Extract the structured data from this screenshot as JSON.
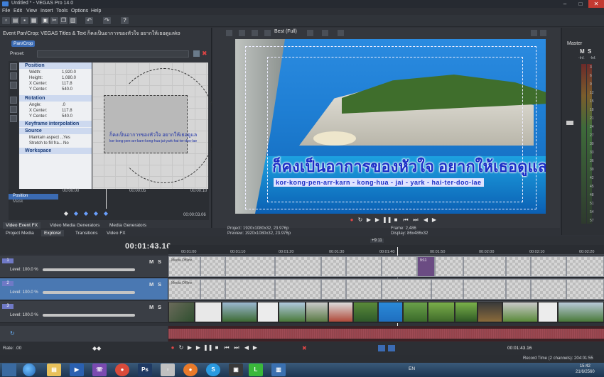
{
  "window": {
    "title": "Untitled * - VEGAS Pro 14.0",
    "min": "–",
    "max": "□",
    "close": "✕"
  },
  "menu": [
    "File",
    "Edit",
    "View",
    "Insert",
    "Tools",
    "Options",
    "Help"
  ],
  "event_panel": {
    "header": "Event Pan/Crop:  VEGAS Titles & Text ก็คงเป็นอาการของหัวใจ อยากให้เธอดูแลkor-kong...",
    "tab": "Pan/Crop",
    "preset_label": "Preset:",
    "sections": {
      "position": "Position",
      "rotation": "Rotation",
      "keyframe": "Keyframe interpolation",
      "source": "Source",
      "workspace": "Workspace"
    },
    "position_rows": [
      {
        "k": "Width:",
        "v": "1,920.0"
      },
      {
        "k": "Height:",
        "v": "1,080.0"
      },
      {
        "k": "X Center:",
        "v": "117.8"
      },
      {
        "k": "Y Center:",
        "v": "540.0"
      }
    ],
    "rotation_rows": [
      {
        "k": "Angle:",
        "v": ".0"
      },
      {
        "k": "X Center:",
        "v": "117.8"
      },
      {
        "k": "Y Center:",
        "v": "540.0"
      }
    ],
    "source_rows": [
      {
        "k": "Maintain aspect ...",
        "v": "Yes"
      },
      {
        "k": "Stretch to fill fra...",
        "v": "No"
      }
    ],
    "canvas_text_line1": "ก็คงเป็นอาการของหัวใจ อยากให้เธอดูแล",
    "canvas_text_line2": "kor-kong-pen-arr-karn-kong-hua-jai-yark-hai-ter-doo-lae",
    "keyframe": {
      "position_label": "Position",
      "mask_label": "Mask",
      "t0": "00:00:00",
      "t1": "00:00:05",
      "t2": "00:00:10",
      "end_time": "00:00:03.06"
    }
  },
  "bottom_tabs": [
    "Video Event FX",
    "Video Media Generators",
    "Media Generators"
  ],
  "bottom_tabs2": [
    "Project Media",
    "Explorer",
    "Transitions",
    "Video FX"
  ],
  "preview": {
    "quality": "Best (Full)",
    "thai_title": "ก็คงเป็นอาการของหัวใจ อยากให้เธอดูแล",
    "thai_sub": "kor-kong-pen-arr-karn - kong-hua - jai - yark -   hai-ter-doo-lae",
    "info": {
      "project": "Project:   1920x1080x32, 23.976p",
      "preview": "Preview:  1920x1080x32, 23.976p",
      "frame": "Frame:     2,486",
      "display": "Display:   86x486x32"
    }
  },
  "master": {
    "label": "Master",
    "m": "M",
    "s": "S",
    "inf": "-Inf.",
    "ticks": [
      "3",
      "6",
      "9",
      "12",
      "15",
      "18",
      "21",
      "24",
      "27",
      "30",
      "33",
      "36",
      "39",
      "42",
      "45",
      "48",
      "51",
      "54",
      "57"
    ]
  },
  "timeline": {
    "timecode": "00:01:43.16",
    "ruler_marker": "+9:11",
    "ruler": [
      "00:01:00",
      "00:01:10",
      "00:01:20",
      "00:01:30",
      "00:01:40",
      "00:01:50",
      "00:02:00",
      "00:02:10",
      "00:02:20"
    ],
    "tracks": [
      {
        "num": "1",
        "level": "Level: 100.0 %",
        "m": "M",
        "s": "S"
      },
      {
        "num": "2",
        "level": "Level: 100.0 %",
        "m": "M",
        "s": "S"
      },
      {
        "num": "3",
        "level": "Level: 100.0 %",
        "m": "M",
        "s": "S"
      }
    ],
    "offline_label": "Media Offline",
    "clip_marker": "9:11",
    "rate": "Rate: .00",
    "end_time": "00:01:43.16"
  },
  "status": {
    "record_time": "Record Time (2 channels): 204:01:55"
  },
  "taskbar": {
    "lang": "EN",
    "time": "15:42",
    "date": "21/6/2560"
  },
  "colors": {
    "accent": "#3b6bb3",
    "thai_text": "#1c2fc7",
    "audio_wave": "#c0606a",
    "close": "#c43a31"
  }
}
